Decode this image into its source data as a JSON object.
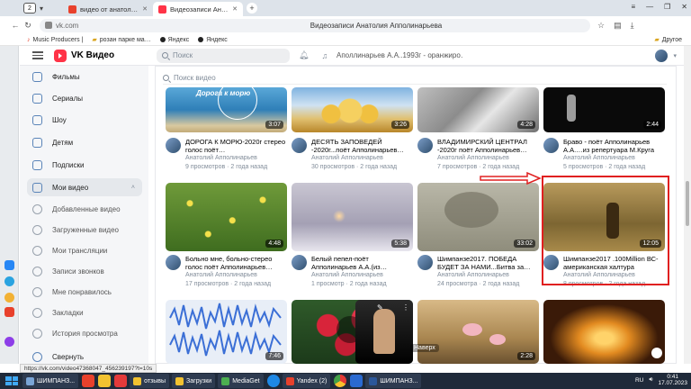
{
  "browser": {
    "tab_count": "2",
    "tabs": [
      {
        "title": "видео от анатолия апол…",
        "favicon_color": "#e8412c",
        "active": false
      },
      {
        "title": "Видеозаписи Анатолия А…",
        "favicon_color": "#ff3347",
        "active": true
      }
    ],
    "url": "vk.com",
    "page_title": "Видеозаписи Анатолия Апполинарьева",
    "bookmarks": [
      "Music Producers |",
      "розан парке ма…",
      "Яндекс",
      "Яндекс"
    ],
    "other_bookmarks": "Другое"
  },
  "vk": {
    "brand": "VK Видео",
    "search_placeholder": "Поиск",
    "now_playing": "Аполлинарьев А.А..1993г - оранжиро…",
    "content_search_placeholder": "Поиск видео"
  },
  "sidebar": {
    "items": [
      {
        "label": "Фильмы",
        "name": "films"
      },
      {
        "label": "Сериалы",
        "name": "series"
      },
      {
        "label": "Шоу",
        "name": "shows"
      },
      {
        "label": "Детям",
        "name": "kids"
      },
      {
        "label": "Подписки",
        "name": "subscriptions"
      },
      {
        "label": "Мои видео",
        "name": "my-videos"
      },
      {
        "label": "Добавленные видео",
        "name": "added"
      },
      {
        "label": "Загруженные видео",
        "name": "uploaded"
      },
      {
        "label": "Мои трансляции",
        "name": "broadcasts"
      },
      {
        "label": "Записи звонков",
        "name": "call-records"
      },
      {
        "label": "Мне понравилось",
        "name": "liked"
      },
      {
        "label": "Закладки",
        "name": "bookmarks"
      },
      {
        "label": "История просмотра",
        "name": "history"
      },
      {
        "label": "Свернуть",
        "name": "collapse"
      }
    ]
  },
  "videos": [
    {
      "title": "ДОРОГА К МОРЮ-2020г стерео голос поёт…",
      "author": "Анатолий Апполинарьев",
      "meta": "9 просмотров · 2 года назад",
      "duration": "3:07",
      "thumb_text": "Дорога к морю"
    },
    {
      "title": "ДЕСЯТЬ ЗАПОВЕДЕЙ -2020г...поёт Апполинарьев…",
      "author": "Анатолий Апполинарьев",
      "meta": "30 просмотров · 2 года назад",
      "duration": "3:26"
    },
    {
      "title": "ВЛАДИМИРСКИЙ ЦЕНТРАЛ -2020г поёт Апполинарьев…",
      "author": "Анатолий Апполинарьев",
      "meta": "7 просмотров · 2 года назад",
      "duration": "4:28"
    },
    {
      "title": "Браво - поёт Апполинарьев А.А.…из репертуара М.Круга",
      "author": "Анатолий Апполинарьев",
      "meta": "5 просмотров · 2 года назад",
      "duration": "2:44"
    },
    {
      "title": "Больно мне, больно-стерео голос поёт Апполинарьев…",
      "author": "Анатолий Апполинарьев",
      "meta": "17 просмотров · 2 года назад",
      "duration": "4:48"
    },
    {
      "title": "Белый пепел-поёт Апполинарьев А.А.(из…",
      "author": "Анатолий Апполинарьев",
      "meta": "1 просмотр · 2 года назад",
      "duration": "5:38"
    },
    {
      "title": "Шимпанзе2017. ПОБЕДА БУДЕТ ЗА НАМИ...Битва за…",
      "author": "Анатолий Апполинарьев",
      "meta": "24 просмотра · 2 года назад",
      "duration": "33:02"
    },
    {
      "title": "Шимпанзе2017 .100Million ВС-американская халтура",
      "author": "Анатолий Апполинарьев",
      "meta": "8 просмотров · 2 года назад",
      "duration": "12:05"
    },
    {
      "duration": "7:46"
    },
    {
      "duration": ""
    },
    {
      "duration": ""
    },
    {
      "duration": "2:28"
    }
  ],
  "scroll_top_label": "Наверх",
  "status_url": "https://vk.com/video47368047_456239197?t=10s",
  "taskbar": {
    "items": [
      "ШИМПАНЗ...",
      "отзывы",
      "Загрузки",
      "MediaGet",
      "Yandex (2)",
      "ШИМПАНЗ..."
    ],
    "lang": "RU",
    "time": "0:41",
    "date": "17.07.2023"
  },
  "colors": {
    "vk_red": "#ff3347",
    "vk_accent": "#5a84b8",
    "highlight_red": "#e02020",
    "taskbar": "#1f2a3a"
  }
}
